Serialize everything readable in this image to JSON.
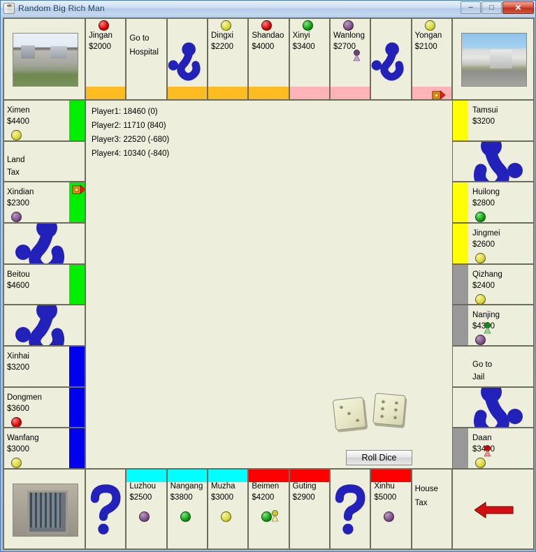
{
  "window": {
    "title": "Random Big Rich Man",
    "app_icon": "java-coffee-icon",
    "buttons": {
      "minimize": "–",
      "maximize": "□",
      "close": "✕"
    }
  },
  "status_lines": [
    "Player1: 18460 (0)",
    "Player2: 11710 (840)",
    "Player3: 22520 (-680)",
    "Player4: 10340 (-840)"
  ],
  "controls": {
    "roll_dice_label": "Roll Dice"
  },
  "dice": [
    {
      "value": 3
    },
    {
      "value": 6
    }
  ],
  "colors": {
    "board_bg": "#eeeedc",
    "orange": "#ffbb22",
    "pink": "#ffb3b8",
    "green": "#00ee00",
    "blue": "#0000ee",
    "yellow": "#ffff00",
    "gray": "#999999",
    "cyan": "#00ffff",
    "red": "#ff0000",
    "glyph_blue": "#2222bb"
  },
  "top_row": [
    {
      "type": "corner",
      "image": "parking-lot-photo",
      "name": "free-parking"
    },
    {
      "type": "property",
      "name": "Jingan",
      "price": "$2000",
      "owner": "red",
      "band": "orange"
    },
    {
      "type": "special",
      "line1": "Go to",
      "line2": "Hospital",
      "band": "none"
    },
    {
      "type": "chance",
      "glyph": "hook",
      "band": "orange"
    },
    {
      "type": "property",
      "name": "Dingxi",
      "price": "$2200",
      "owner": "yellow",
      "band": "orange"
    },
    {
      "type": "property",
      "name": "Shandao",
      "price": "$4000",
      "owner": "red",
      "band": "orange"
    },
    {
      "type": "property",
      "name": "Xinyi",
      "price": "$3400",
      "owner": "green",
      "band": "pink"
    },
    {
      "type": "property",
      "name": "Wanlong",
      "price": "$2700",
      "owner": "purple",
      "band": "pink",
      "pawn": "purple"
    },
    {
      "type": "chance",
      "glyph": "hook",
      "band": "none"
    },
    {
      "type": "property",
      "name": "Yongan",
      "price": "$2100",
      "owner": "yellow",
      "band": "pink",
      "marker": "house-red-flag"
    },
    {
      "type": "corner",
      "image": "hospital-photo",
      "name": "hospital"
    }
  ],
  "left_col": [
    {
      "type": "property",
      "name": "Ximen",
      "price": "$4400",
      "owner": "yellow",
      "band": "green"
    },
    {
      "type": "special",
      "line1": "Land",
      "line2": "Tax",
      "band": "none"
    },
    {
      "type": "property",
      "name": "Xindian",
      "price": "$2300",
      "owner": "purple",
      "band": "green",
      "marker": "house-red-flag"
    },
    {
      "type": "chance",
      "glyph": "hook",
      "band": "none"
    },
    {
      "type": "property",
      "name": "Beitou",
      "price": "$4600",
      "owner": "none",
      "band": "green"
    },
    {
      "type": "chance",
      "glyph": "hook",
      "band": "none"
    },
    {
      "type": "property",
      "name": "Xinhai",
      "price": "$3200",
      "owner": "none",
      "band": "blue"
    },
    {
      "type": "property",
      "name": "Dongmen",
      "price": "$3600",
      "owner": "red",
      "band": "blue"
    },
    {
      "type": "property",
      "name": "Wanfang",
      "price": "$3000",
      "owner": "yellow",
      "band": "blue"
    }
  ],
  "right_col": [
    {
      "type": "property",
      "name": "Tamsui",
      "price": "$3200",
      "owner": "none",
      "band": "yellow"
    },
    {
      "type": "chance",
      "glyph": "hook",
      "band": "none"
    },
    {
      "type": "property",
      "name": "Huilong",
      "price": "$2800",
      "owner": "green",
      "band": "yellow"
    },
    {
      "type": "property",
      "name": "Jingmei",
      "price": "$2600",
      "owner": "yellow",
      "band": "yellow"
    },
    {
      "type": "property",
      "name": "Qizhang",
      "price": "$2400",
      "owner": "yellow",
      "band": "gray"
    },
    {
      "type": "property",
      "name": "Nanjing",
      "price": "$4300",
      "owner": "purple",
      "band": "gray",
      "pawn": "green"
    },
    {
      "type": "special",
      "line1": "Go to",
      "line2": "Jail",
      "band": "none"
    },
    {
      "type": "chance",
      "glyph": "hook",
      "band": "none"
    },
    {
      "type": "property",
      "name": "Daan",
      "price": "$3400",
      "owner": "yellow",
      "band": "gray",
      "pawn": "red"
    }
  ],
  "bottom_row": [
    {
      "type": "corner",
      "image": "jail-photo",
      "name": "jail"
    },
    {
      "type": "chance",
      "glyph": "question",
      "band": "none"
    },
    {
      "type": "property",
      "name": "Luzhou",
      "price": "$2500",
      "owner": "purple",
      "band": "cyan"
    },
    {
      "type": "property",
      "name": "Nangang",
      "price": "$3800",
      "owner": "green",
      "band": "cyan"
    },
    {
      "type": "property",
      "name": "Muzha",
      "price": "$3000",
      "owner": "yellow",
      "band": "cyan"
    },
    {
      "type": "property",
      "name": "Beimen",
      "price": "$4200",
      "owner": "green",
      "band": "red",
      "pawn": "yellow"
    },
    {
      "type": "property",
      "name": "Guting",
      "price": "$2900",
      "owner": "none",
      "band": "red"
    },
    {
      "type": "chance",
      "glyph": "question",
      "band": "none"
    },
    {
      "type": "property",
      "name": "Xinhu",
      "price": "$5000",
      "owner": "purple",
      "band": "red"
    },
    {
      "type": "special",
      "line1": "House",
      "line2": "Tax",
      "band": "none"
    },
    {
      "type": "corner",
      "image": "arrow-left",
      "name": "go-start"
    }
  ]
}
